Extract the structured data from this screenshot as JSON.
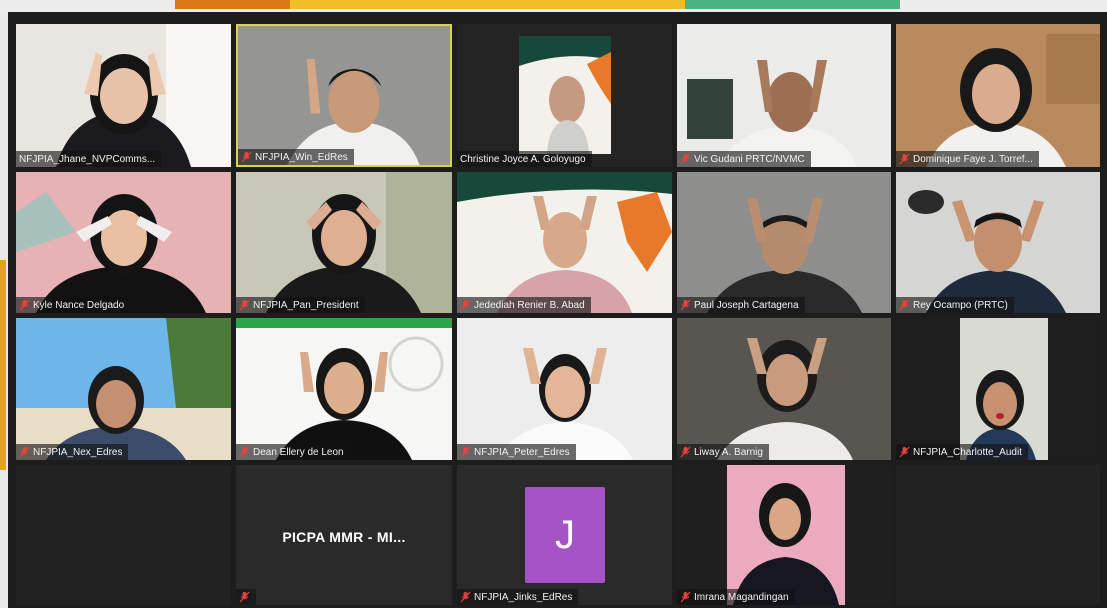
{
  "app": {
    "view": "gallery",
    "accent_color": "#d8d44a",
    "muted_icon_color": "#e8433c",
    "avatar_color": "#a653c8"
  },
  "participants": [
    {
      "name": "NFJPIA_Jhane_NVPComms...",
      "muted": false
    },
    {
      "name": "NFJPIA_Win_EdRes",
      "muted": true,
      "active_speaker": true
    },
    {
      "name": "Christine Joyce A. Goloyugo",
      "muted": false
    },
    {
      "name": "Vic Gudani PRTC/NVMC",
      "muted": true
    },
    {
      "name": "Dominique Faye J. Torref...",
      "muted": true
    },
    {
      "name": "Kyle Nance Delgado",
      "muted": true
    },
    {
      "name": "NFJPIA_Pan_President",
      "muted": true
    },
    {
      "name": "Jedediah Renier B. Abad",
      "muted": true
    },
    {
      "name": "Paul Joseph Cartagena",
      "muted": true
    },
    {
      "name": "Rey Ocampo (PRTC)",
      "muted": true
    },
    {
      "name": "NFJPIA_Nex_Edres",
      "muted": true
    },
    {
      "name": "Dean Ellery de Leon",
      "muted": true
    },
    {
      "name": "NFJPIA_Peter_Edres",
      "muted": true
    },
    {
      "name": "Liway A. Barnig",
      "muted": true
    },
    {
      "name": "NFJPIA_Charlotte_Audit",
      "muted": true
    },
    {
      "name": "PICPA MMR - MI...",
      "muted": true,
      "video_off": true
    },
    {
      "name": "NFJPIA_Jinks_EdRes",
      "muted": true,
      "avatar_letter": "J"
    },
    {
      "name": "Imrana Magandingan",
      "muted": true
    }
  ]
}
